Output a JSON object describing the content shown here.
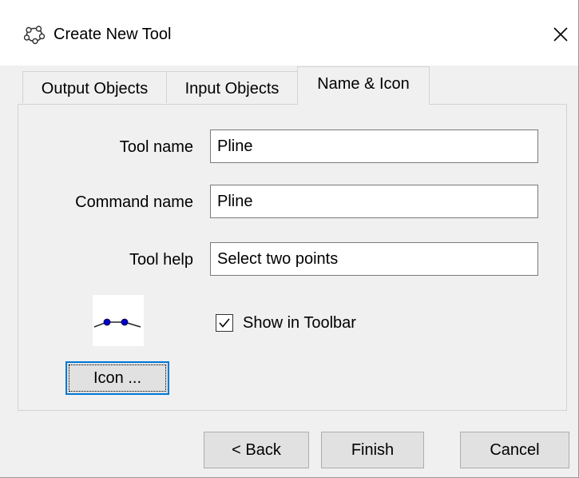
{
  "window": {
    "title": "Create New Tool",
    "close_glyph": "✕",
    "app_icon": "geogebra-icon",
    "close_icon": "close-icon"
  },
  "tabs": [
    {
      "label": "Output Objects",
      "active": false
    },
    {
      "label": "Input Objects",
      "active": false
    },
    {
      "label": "Name & Icon",
      "active": true
    }
  ],
  "form": {
    "tool_name_label": "Tool name",
    "tool_name_value": "Pline",
    "command_name_label": "Command name",
    "command_name_value": "Pline",
    "tool_help_label": "Tool help",
    "tool_help_value": "Select two points",
    "show_in_toolbar_label": "Show in Toolbar",
    "show_in_toolbar_checked": true,
    "icon_button_label": "Icon ...",
    "tool_icon": "polyline-icon"
  },
  "footer": {
    "back_label": "< Back",
    "finish_label": "Finish",
    "cancel_label": "Cancel"
  },
  "colors": {
    "focus_accent": "#0078d7",
    "icon_point": "#0000cc"
  }
}
